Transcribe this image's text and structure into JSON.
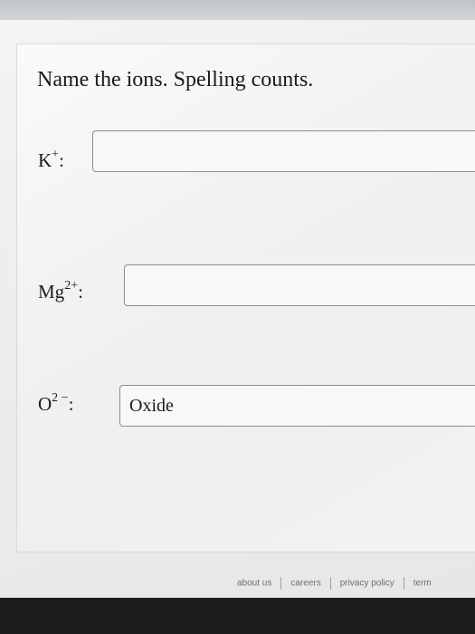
{
  "question": {
    "title": "Name the ions. Spelling counts."
  },
  "ions": [
    {
      "symbol": "K",
      "charge": "+",
      "suffix": ":",
      "value": ""
    },
    {
      "symbol": "Mg",
      "charge": "2+",
      "suffix": ":",
      "value": ""
    },
    {
      "symbol": "O",
      "charge": "2 −",
      "suffix": ":",
      "value": "Oxide"
    }
  ],
  "footer": {
    "links": [
      "about us",
      "careers",
      "privacy policy",
      "term"
    ]
  }
}
